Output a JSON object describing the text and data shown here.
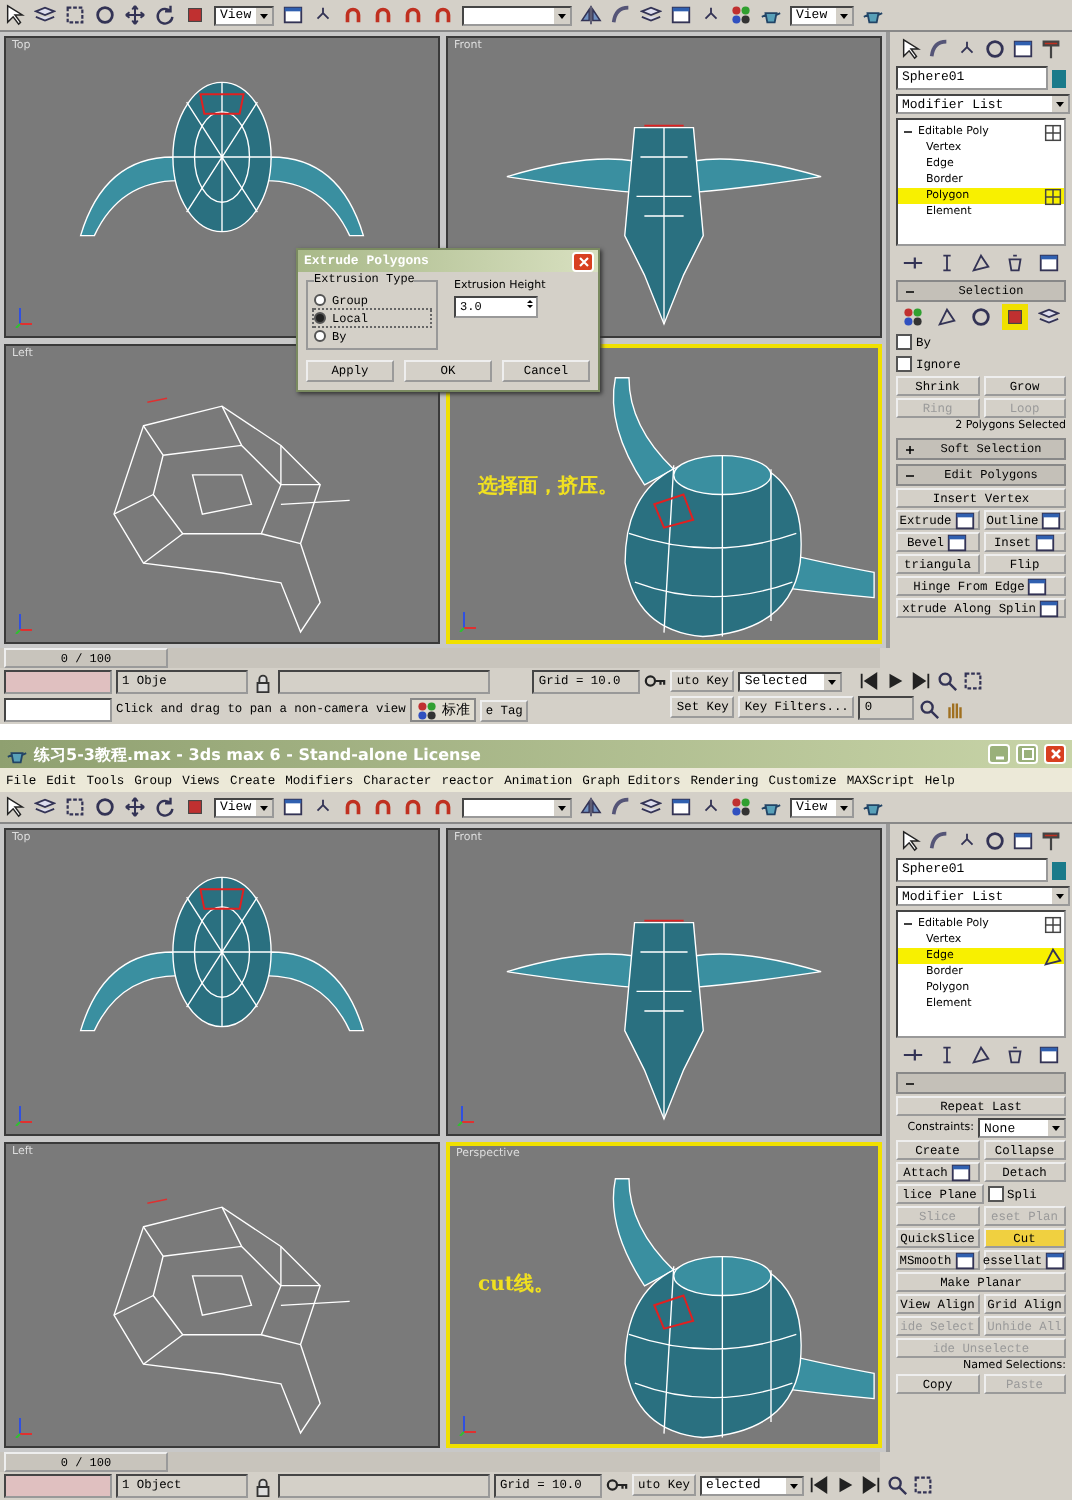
{
  "screens": [
    {
      "toolbar": {
        "view_dropdown": "View",
        "panel_dropdown": "View"
      },
      "viewports": [
        {
          "kind": "top",
          "label": "Top",
          "active": false
        },
        {
          "kind": "front",
          "label": "Front",
          "active": false
        },
        {
          "kind": "left",
          "label": "Left",
          "active": false
        },
        {
          "kind": "persp",
          "active": true,
          "annotation": "选择面，挤压。"
        }
      ],
      "dialog": {
        "title": "Extrude Polygons",
        "group_title": "Extrusion Type",
        "options": [
          {
            "label": "Group",
            "selected": false
          },
          {
            "label": "Local",
            "selected": true
          },
          {
            "label": "By",
            "selected": false
          }
        ],
        "height_label": "Extrusion Height",
        "height_value": "3.0",
        "buttons": [
          "Apply",
          "OK",
          "Cancel"
        ]
      },
      "panel": {
        "object_name": "Sphere01",
        "modifier_list": "Modifier List",
        "stack": {
          "label": "Editable Poly",
          "expanded": true,
          "children": [
            {
              "label": "Vertex",
              "selected": false
            },
            {
              "label": "Edge",
              "selected": false
            },
            {
              "label": "Border",
              "selected": false
            },
            {
              "label": "Polygon",
              "selected": true
            },
            {
              "label": "Element",
              "selected": false
            }
          ]
        },
        "rollouts": [
          {
            "title": "Selection",
            "expanded": true,
            "rows": [
              {
                "items": [
                  {
                    "kind": "subobjects",
                    "levels": [
                      {
                        "selected": false
                      },
                      {
                        "selected": false
                      },
                      {
                        "selected": false
                      },
                      {
                        "selected": true
                      },
                      {
                        "selected": false
                      }
                    ]
                  }
                ]
              },
              {
                "items": [
                  {
                    "kind": "checkbox",
                    "label": "By",
                    "checked": false
                  }
                ]
              },
              {
                "items": [
                  {
                    "kind": "checkbox",
                    "label": "Ignore",
                    "checked": false
                  }
                ]
              },
              {
                "items": [
                  {
                    "kind": "button",
                    "label": "Shrink",
                    "disabled": false
                  },
                  {
                    "kind": "button",
                    "label": "Grow",
                    "disabled": false
                  }
                ]
              },
              {
                "items": [
                  {
                    "kind": "button",
                    "label": "Ring",
                    "disabled": true
                  },
                  {
                    "kind": "button",
                    "label": "Loop",
                    "disabled": true
                  }
                ]
              },
              {
                "items": [
                  {
                    "kind": "note",
                    "label": "2 Polygons Selected"
                  }
                ]
              }
            ]
          },
          {
            "title": "Soft Selection",
            "expanded": false
          },
          {
            "title": "Edit Polygons",
            "expanded": true,
            "rows": [
              {
                "items": [
                  {
                    "kind": "button",
                    "label": "Insert Vertex",
                    "disabled": false
                  }
                ]
              },
              {
                "items": [
                  {
                    "kind": "button",
                    "label": "Extrude",
                    "disabled": false,
                    "settings": true
                  },
                  {
                    "kind": "button",
                    "label": "Outline",
                    "disabled": false,
                    "settings": true
                  }
                ]
              },
              {
                "items": [
                  {
                    "kind": "button",
                    "label": "Bevel",
                    "disabled": false,
                    "settings": true
                  },
                  {
                    "kind": "button",
                    "label": "Inset",
                    "disabled": false,
                    "settings": true
                  }
                ]
              },
              {
                "items": [
                  {
                    "kind": "button",
                    "label": "triangula",
                    "disabled": false
                  },
                  {
                    "kind": "button",
                    "label": "Flip",
                    "disabled": false
                  }
                ]
              },
              {
                "items": [
                  {
                    "kind": "button",
                    "label": "Hinge From Edge",
                    "disabled": false,
                    "settings": true
                  }
                ]
              },
              {
                "items": [
                  {
                    "kind": "button",
                    "label": "xtrude Along Splin",
                    "disabled": false,
                    "settings": true
                  }
                ]
              }
            ]
          }
        ]
      },
      "time_slider": {
        "label": "0 / 100",
        "level": 0
      },
      "status": {
        "objects": "1 Obje",
        "prompt": "Click and drag to pan a non-camera view",
        "ime": "标准",
        "time_tag": "e Tag",
        "grid": "Grid = 10.0",
        "auto_key": "uto Key",
        "key_mode": "Selected",
        "set_key": "Set Key",
        "key_filters": "Key Filters...",
        "frame": "0"
      }
    },
    {
      "title": "练习5-3教程.max - 3ds max 6 - Stand-alone License",
      "menu": [
        "File",
        "Edit",
        "Tools",
        "Group",
        "Views",
        "Create",
        "Modifiers",
        "Character",
        "reactor",
        "Animation",
        "Graph Editors",
        "Rendering",
        "Customize",
        "MAXScript",
        "Help"
      ],
      "toolbar": {
        "view_dropdown": "View",
        "panel_dropdown": "View"
      },
      "viewports": [
        {
          "kind": "top",
          "label": "Top",
          "active": false
        },
        {
          "kind": "front",
          "label": "Front",
          "active": false
        },
        {
          "kind": "left",
          "label": "Left",
          "active": false
        },
        {
          "kind": "persp",
          "label": "Perspective",
          "active": true,
          "annotation": "cut线。"
        }
      ],
      "panel": {
        "object_name": "Sphere01",
        "modifier_list": "Modifier List",
        "stack": {
          "label": "Editable Poly",
          "expanded": true,
          "children": [
            {
              "label": "Vertex",
              "selected": false
            },
            {
              "label": "Edge",
              "selected": true
            },
            {
              "label": "Border",
              "selected": false
            },
            {
              "label": "Polygon",
              "selected": false
            },
            {
              "label": "Element",
              "selected": false
            }
          ]
        },
        "rollouts": [
          {
            "expanded": true,
            "rows": [
              {
                "items": [
                  {
                    "kind": "button",
                    "label": "Repeat Last",
                    "disabled": false
                  }
                ]
              },
              {
                "items": [
                  {
                    "kind": "dropdown",
                    "label": "Constraints:",
                    "value": "None"
                  }
                ]
              },
              {
                "items": [
                  {
                    "kind": "button",
                    "label": "Create",
                    "disabled": false
                  },
                  {
                    "kind": "button",
                    "label": "Collapse",
                    "disabled": false
                  }
                ]
              },
              {
                "items": [
                  {
                    "kind": "button",
                    "label": "Attach",
                    "disabled": false,
                    "settings": true
                  },
                  {
                    "kind": "button",
                    "label": "Detach",
                    "disabled": false
                  }
                ]
              },
              {
                "items": [
                  {
                    "kind": "button",
                    "label": "lice Plane",
                    "disabled": false
                  },
                  {
                    "kind": "checkbox",
                    "label": "Spli",
                    "checked": false
                  }
                ]
              },
              {
                "items": [
                  {
                    "kind": "button",
                    "label": "Slice",
                    "disabled": true
                  },
                  {
                    "kind": "button",
                    "label": "eset Plan",
                    "disabled": true
                  }
                ]
              },
              {
                "items": [
                  {
                    "kind": "button",
                    "label": "QuickSlice",
                    "disabled": false,
                    "pressed": false
                  },
                  {
                    "kind": "button",
                    "label": "Cut",
                    "disabled": false,
                    "pressed": true
                  }
                ]
              },
              {
                "items": [
                  {
                    "kind": "button",
                    "label": "MSmooth",
                    "disabled": false,
                    "settings": true
                  },
                  {
                    "kind": "button",
                    "label": "essellat",
                    "disabled": false,
                    "settings": true
                  }
                ]
              },
              {
                "items": [
                  {
                    "kind": "button",
                    "label": "Make Planar",
                    "disabled": false
                  }
                ]
              },
              {
                "items": [
                  {
                    "kind": "button",
                    "label": "View Align",
                    "disabled": false
                  },
                  {
                    "kind": "button",
                    "label": "Grid Align",
                    "disabled": false
                  }
                ]
              },
              {
                "items": [
                  {
                    "kind": "button",
                    "label": "ide Select",
                    "disabled": true
                  },
                  {
                    "kind": "button",
                    "label": "Unhide All",
                    "disabled": true
                  }
                ]
              },
              {
                "items": [
                  {
                    "kind": "button",
                    "label": "ide Unselecte",
                    "disabled": true
                  }
                ]
              },
              {
                "items": [
                  {
                    "kind": "note",
                    "label": "Named Selections:"
                  }
                ]
              },
              {
                "items": [
                  {
                    "kind": "button",
                    "label": "Copy",
                    "disabled": false
                  },
                  {
                    "kind": "button",
                    "label": "Paste",
                    "disabled": true
                  }
                ]
              }
            ]
          }
        ]
      },
      "time_slider": {
        "label": "0 / 100",
        "level": 0
      },
      "status": {
        "objects": "1 Object",
        "grid": "Grid = 10.0",
        "auto_key": "uto Key",
        "key_mode": "elected"
      }
    }
  ]
}
